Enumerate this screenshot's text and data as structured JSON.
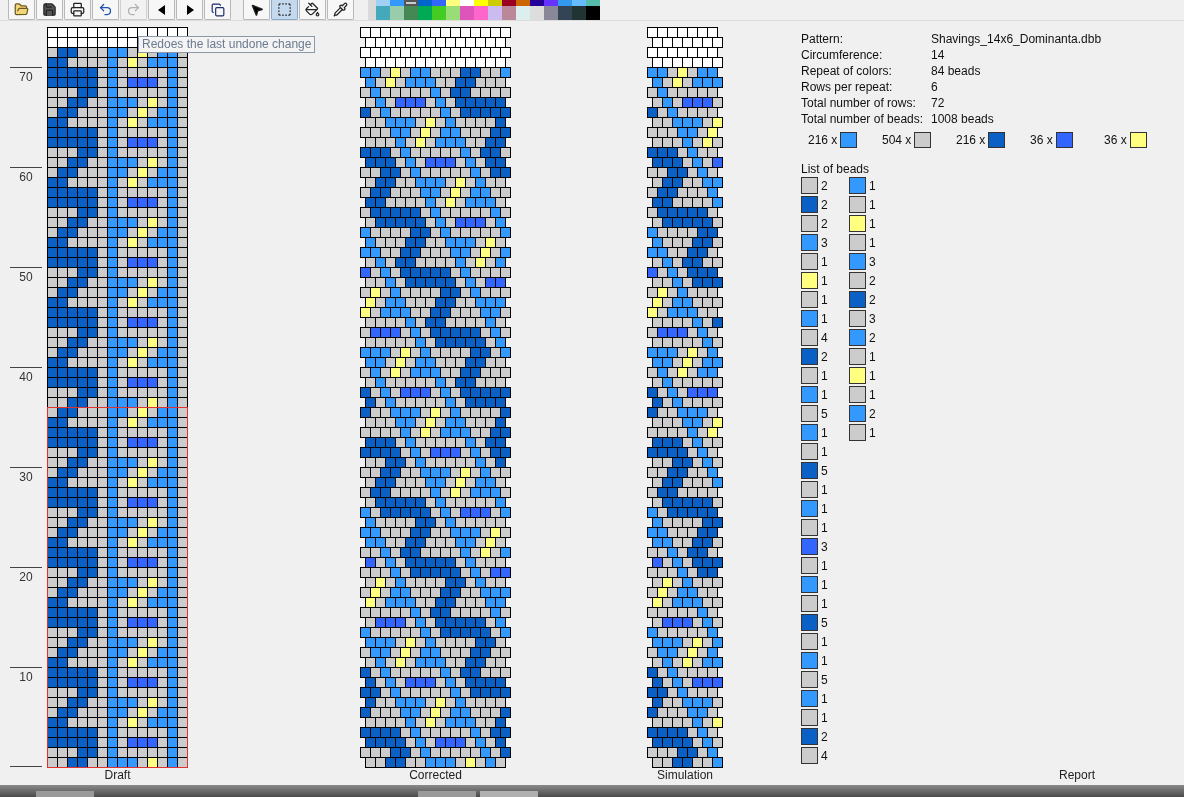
{
  "toolbar": {
    "groups": [
      [
        {
          "kind": "open",
          "disabled": false,
          "selected": false
        },
        {
          "kind": "save",
          "disabled": false,
          "selected": false
        },
        {
          "kind": "print",
          "disabled": false,
          "selected": false
        },
        {
          "kind": "undo",
          "disabled": false,
          "selected": false
        },
        {
          "kind": "redo",
          "disabled": true,
          "selected": false
        },
        {
          "kind": "previous",
          "disabled": false,
          "selected": false
        },
        {
          "kind": "next",
          "disabled": false,
          "selected": false
        },
        {
          "kind": "copy",
          "disabled": false,
          "selected": false
        }
      ],
      [
        {
          "kind": "pointer",
          "disabled": false,
          "selected": false
        },
        {
          "kind": "select",
          "disabled": false,
          "selected": true
        },
        {
          "kind": "fill",
          "disabled": false,
          "selected": false
        },
        {
          "kind": "pipette",
          "disabled": false,
          "selected": false
        }
      ]
    ]
  },
  "palette": {
    "rows": [
      [
        {
          "color": "#9fd0f5",
          "selected": false
        },
        {
          "color": "#3399ff",
          "selected": false
        },
        {
          "color": "#cccccc",
          "selected": true
        },
        {
          "color": "#0066cc",
          "selected": false
        },
        {
          "color": "#3366ff",
          "selected": false
        },
        {
          "color": "#ffff80",
          "selected": false
        },
        {
          "color": "#ffffff",
          "selected": false
        },
        {
          "color": "#ffff00",
          "selected": false
        },
        {
          "color": "#cccc00",
          "selected": false
        },
        {
          "color": "#990022",
          "selected": false
        },
        {
          "color": "#cc6600",
          "selected": false
        },
        {
          "color": "#220099",
          "selected": false
        },
        {
          "color": "#6633ff",
          "selected": false
        },
        {
          "color": "#3399ee",
          "selected": false
        },
        {
          "color": "#66bbff",
          "selected": false
        },
        {
          "color": "#55bbaa",
          "selected": false
        }
      ],
      [
        {
          "color": "#44aabb",
          "selected": false
        },
        {
          "color": "#99ccaa",
          "selected": false
        },
        {
          "color": "#448855",
          "selected": false
        },
        {
          "color": "#00aa55",
          "selected": false
        },
        {
          "color": "#44cc22",
          "selected": false
        },
        {
          "color": "#99dd77",
          "selected": false
        },
        {
          "color": "#dd55bb",
          "selected": false
        },
        {
          "color": "#ff66cc",
          "selected": false
        },
        {
          "color": "#ccbbee",
          "selected": false
        },
        {
          "color": "#bb8899",
          "selected": false
        },
        {
          "color": "#ddeeee",
          "selected": false
        },
        {
          "color": "#dddddd",
          "selected": false
        },
        {
          "color": "#888899",
          "selected": false
        },
        {
          "color": "#334455",
          "selected": false
        },
        {
          "color": "#223333",
          "selected": false
        },
        {
          "color": "#000000",
          "selected": false
        }
      ]
    ]
  },
  "tooltip": {
    "text": "Redoes the last undone change"
  },
  "ruler": {
    "labels": [
      "70",
      "60",
      "50",
      "40",
      "30",
      "20",
      "10"
    ]
  },
  "panels": [
    {
      "kind": "draft",
      "label": "Draft"
    },
    {
      "kind": "corrected",
      "label": "Corrected"
    },
    {
      "kind": "simulation",
      "label": "Simulation"
    }
  ],
  "report": {
    "label": "Report",
    "fields": [
      {
        "label": "Pattern:",
        "value": "Shavings_14x6_Dominanta.dbb"
      },
      {
        "label": "Circumference:",
        "value": "14"
      },
      {
        "label": "Repeat of colors:",
        "value": "84 beads"
      },
      {
        "label": "Rows per repeat:",
        "value": "6"
      },
      {
        "label": "Total number of rows:",
        "value": "72"
      },
      {
        "label": "Total number of beads:",
        "value": "1008 beads"
      }
    ],
    "color_counts": [
      {
        "count": "216 x",
        "color": "#3399ff"
      },
      {
        "count": "504 x",
        "color": "#cccccc"
      },
      {
        "count": "216 x",
        "color": "#0a60c4"
      },
      {
        "count": "36 x",
        "color": "#3366ff"
      },
      {
        "count": "36 x",
        "color": "#ffff80"
      }
    ],
    "list_title": "List of beads",
    "bead_columns": [
      [
        {
          "color": "#cccccc",
          "count": "2"
        },
        {
          "color": "#0a60c4",
          "count": "2"
        },
        {
          "color": "#cccccc",
          "count": "2"
        },
        {
          "color": "#3399ff",
          "count": "3"
        },
        {
          "color": "#cccccc",
          "count": "1"
        },
        {
          "color": "#ffff80",
          "count": "1"
        },
        {
          "color": "#cccccc",
          "count": "1"
        },
        {
          "color": "#3399ff",
          "count": "1"
        },
        {
          "color": "#cccccc",
          "count": "4"
        },
        {
          "color": "#0a60c4",
          "count": "2"
        },
        {
          "color": "#cccccc",
          "count": "1"
        },
        {
          "color": "#3399ff",
          "count": "1"
        },
        {
          "color": "#cccccc",
          "count": "5"
        },
        {
          "color": "#3399ff",
          "count": "1"
        },
        {
          "color": "#cccccc",
          "count": "1"
        },
        {
          "color": "#0a60c4",
          "count": "5"
        },
        {
          "color": "#cccccc",
          "count": "1"
        },
        {
          "color": "#3399ff",
          "count": "1"
        },
        {
          "color": "#cccccc",
          "count": "1"
        },
        {
          "color": "#3366ff",
          "count": "3"
        },
        {
          "color": "#cccccc",
          "count": "1"
        },
        {
          "color": "#3399ff",
          "count": "1"
        },
        {
          "color": "#cccccc",
          "count": "1"
        },
        {
          "color": "#0a60c4",
          "count": "5"
        },
        {
          "color": "#cccccc",
          "count": "1"
        },
        {
          "color": "#3399ff",
          "count": "1"
        },
        {
          "color": "#cccccc",
          "count": "5"
        },
        {
          "color": "#3399ff",
          "count": "1"
        },
        {
          "color": "#cccccc",
          "count": "1"
        },
        {
          "color": "#0a60c4",
          "count": "2"
        },
        {
          "color": "#cccccc",
          "count": "4"
        }
      ],
      [
        {
          "color": "#3399ff",
          "count": "1"
        },
        {
          "color": "#cccccc",
          "count": "1"
        },
        {
          "color": "#ffff80",
          "count": "1"
        },
        {
          "color": "#cccccc",
          "count": "1"
        },
        {
          "color": "#3399ff",
          "count": "3"
        },
        {
          "color": "#cccccc",
          "count": "2"
        },
        {
          "color": "#0a60c4",
          "count": "2"
        },
        {
          "color": "#cccccc",
          "count": "3"
        },
        {
          "color": "#3399ff",
          "count": "2"
        },
        {
          "color": "#cccccc",
          "count": "1"
        },
        {
          "color": "#ffff80",
          "count": "1"
        },
        {
          "color": "#cccccc",
          "count": "1"
        },
        {
          "color": "#3399ff",
          "count": "2"
        },
        {
          "color": "#cccccc",
          "count": "1"
        }
      ]
    ]
  }
}
